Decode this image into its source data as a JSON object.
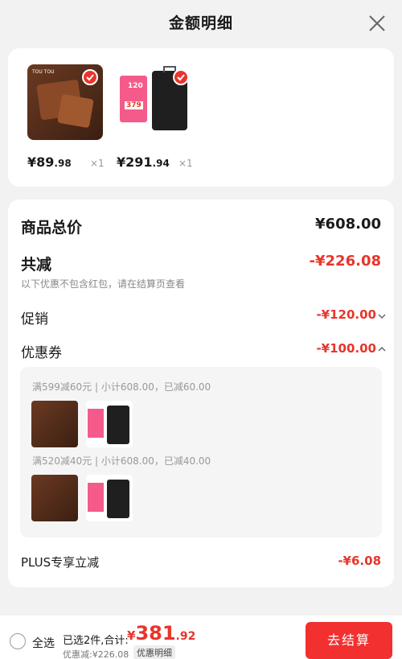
{
  "header": {
    "title": "金额明细"
  },
  "products": [
    {
      "price_int": "¥89",
      "price_dec": ".98",
      "qty": "×1",
      "thumb_text": "TOU TOU"
    },
    {
      "price_int": "¥291",
      "price_dec": ".94",
      "qty": "×1",
      "tag_number": "120",
      "tag_price": "379"
    }
  ],
  "summary": {
    "total_label": "商品总价",
    "total_value": "¥608.00",
    "discount_label": "共减",
    "discount_value": "-¥226.08",
    "discount_note": "以下优惠不包含红包，请在结算页查看",
    "promo_label": "促销",
    "promo_value": "-¥120.00",
    "coupon_label": "优惠券",
    "coupon_value": "-¥100.00",
    "coupon_groups": [
      {
        "title": "满599减60元 | 小计608.00，已减60.00"
      },
      {
        "title": "满520减40元 | 小计608.00，已减40.00"
      }
    ],
    "plus_label": "PLUS专享立减",
    "plus_value": "-¥6.08"
  },
  "bottom": {
    "select_all": "全选",
    "selected_info": "已选2件,合计:",
    "total_currency": "¥",
    "total_int": "381",
    "total_dec": ".92",
    "discount_line": "优惠减:¥226.08",
    "detail_tag": "优惠明细",
    "checkout_label": "去结算"
  },
  "colors": {
    "accent": "#e8352b",
    "checkout": "#f23030"
  }
}
